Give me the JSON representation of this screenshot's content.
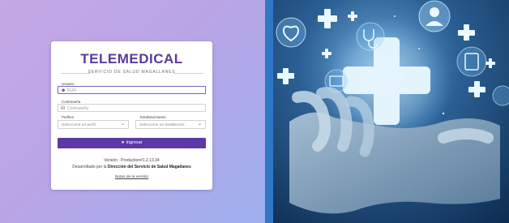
{
  "app": {
    "title": "TELEMEDICAL",
    "subtitle": "SERVICIO DE SALUD MAGALLANES"
  },
  "form": {
    "user_label": "Usuario",
    "user_placeholder": "RUN",
    "password_label": "Contraseña",
    "password_placeholder": "Contraseña",
    "profile_label": "Perfiles",
    "profile_value": "Seleccione un perfil",
    "facility_label": "Establecimiento",
    "facility_value": "Seleccione un establecimi",
    "submit_label": "Ingresar"
  },
  "footer": {
    "version": "Versión : Production#1.2.13.34",
    "developed_prefix": "Desarrollado por la",
    "developed_org": "Dirección del Servicio de Salud Magallanes",
    "notes_link": "Notas de la versión"
  },
  "icons": {
    "user": "user-icon",
    "lock": "lock-icon",
    "submit": "sign-in-icon",
    "chevron": "chevron-down-icon"
  },
  "colors": {
    "brand": "#5a3a9f",
    "button": "#5b3aa6",
    "divider": "#2f78c6"
  }
}
